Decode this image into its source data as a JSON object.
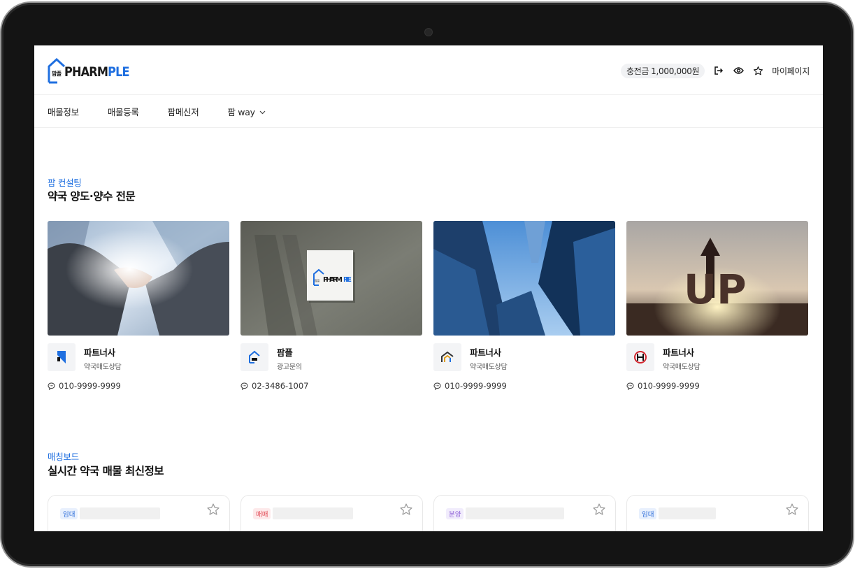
{
  "header": {
    "logo_kor": "팜플",
    "logo_word_a": "PHARM",
    "logo_word_b": "PLE",
    "balance_label": "충전금",
    "balance_amount": "1,000,000원",
    "mypage_label": "마이페이지",
    "icons": [
      "logout-icon",
      "eye-icon",
      "star-icon"
    ]
  },
  "nav": {
    "items": [
      "매물정보",
      "매물등록",
      "팜메신저",
      "팜 way"
    ]
  },
  "consulting": {
    "label": "팜 컨설팅",
    "title": "약국 양도·양수 전문",
    "cards": [
      {
        "image": "handshake-photo",
        "name": "파트너사",
        "sub": "약국매도상담",
        "phone": "010-9999-9999"
      },
      {
        "image": "pharmple-sign-photo",
        "name": "팜플",
        "sub": "광고문의",
        "phone": "02-3486-1007"
      },
      {
        "image": "skyscrapers-photo",
        "name": "파트너사",
        "sub": "약국매도상담",
        "phone": "010-9999-9999"
      },
      {
        "image": "up-arrow-photo",
        "name": "파트너사",
        "sub": "약국매도상담",
        "phone": "010-9999-9999"
      }
    ]
  },
  "matching": {
    "label": "매칭보드",
    "title": "실시간 약국 매물 최신정보",
    "cards": [
      {
        "tag": "임대",
        "tag_color": "#2a6bd8"
      },
      {
        "tag": "매매",
        "tag_color": "#e24a55"
      },
      {
        "tag": "분양",
        "tag_color": "#8b5cd6"
      },
      {
        "tag": "임대",
        "tag_color": "#2a6bd8"
      }
    ]
  },
  "sign_text": {
    "kor": "팜플",
    "word_a": "PHARM",
    "word_b": "PLE"
  },
  "up_text": "UP"
}
